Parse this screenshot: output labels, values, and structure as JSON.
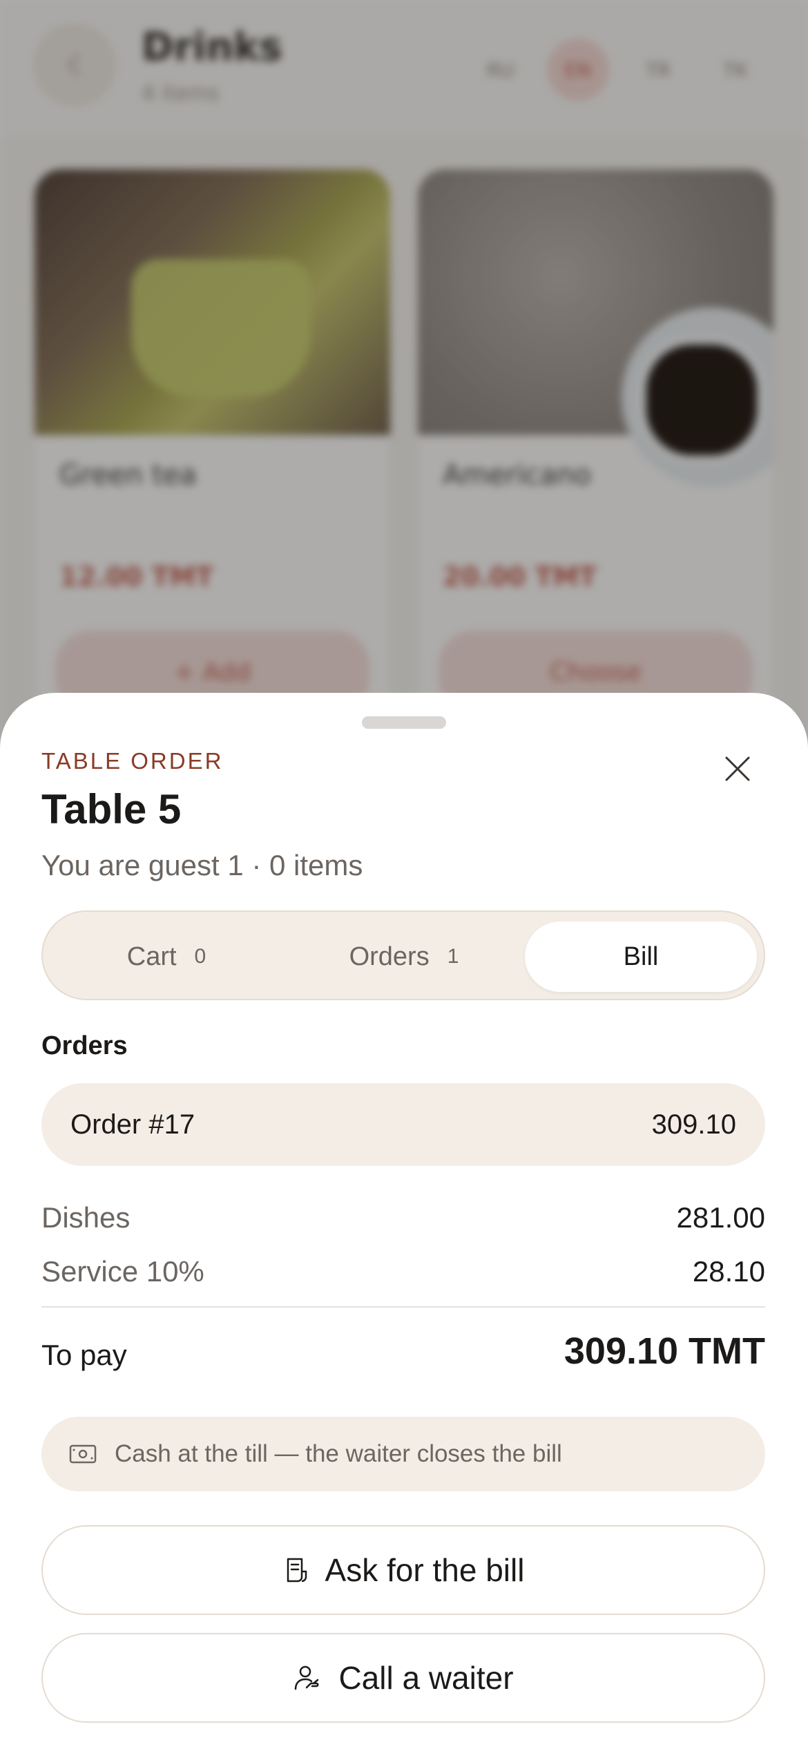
{
  "background": {
    "header": {
      "title": "Drinks",
      "subtitle": "4 items",
      "languages": [
        {
          "code": "RU",
          "active": false
        },
        {
          "code": "EN",
          "active": true
        },
        {
          "code": "TR",
          "active": false
        },
        {
          "code": "TK",
          "active": false
        }
      ]
    },
    "products": [
      {
        "name": "Green tea",
        "price": "12.00 TMT",
        "button": "+ Add"
      },
      {
        "name": "Americano",
        "price": "20.00 TMT",
        "button": "Choose"
      }
    ]
  },
  "sheet": {
    "eyebrow": "TABLE ORDER",
    "title": "Table 5",
    "subtitle": "You are guest 1 · 0 items",
    "tabs": [
      {
        "label": "Cart",
        "count": "0",
        "active": false
      },
      {
        "label": "Orders",
        "count": "1",
        "active": false
      },
      {
        "label": "Bill",
        "count": "",
        "active": true
      }
    ],
    "orders_label": "Orders",
    "orders": [
      {
        "name": "Order #17",
        "amount": "309.10"
      }
    ],
    "summary": {
      "dishes_label": "Dishes",
      "dishes_value": "281.00",
      "service_label": "Service 10%",
      "service_value": "28.10",
      "total_label": "To pay",
      "total_value": "309.10 TMT"
    },
    "payment_note": "Cash at the till — the waiter closes the bill",
    "buttons": {
      "ask_bill": "Ask for the bill",
      "call_waiter": "Call a waiter"
    }
  },
  "colors": {
    "accent": "#8a3b25",
    "brand_pink": "#c25a49",
    "sheet_surface": "#f3ede6"
  },
  "icons": {
    "close": "close-icon",
    "back": "chevron-left-icon",
    "payment": "cash-icon",
    "bill": "receipt-icon",
    "waiter": "person-hand-icon"
  }
}
